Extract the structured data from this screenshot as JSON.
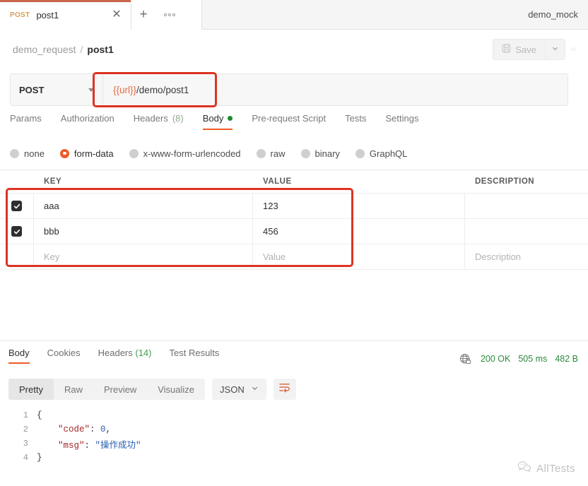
{
  "tab": {
    "method": "POST",
    "name": "post1",
    "close_icon": "close-icon",
    "new_tab_icon": "plus-icon",
    "more_icon": "more-options-icon",
    "environment": "demo_mock"
  },
  "breadcrumb": {
    "collection": "demo_request",
    "separator": "/",
    "current": "post1",
    "save_label": "Save",
    "save_icon": "floppy-disk-icon",
    "save_caret_icon": "chevron-down-icon"
  },
  "url_bar": {
    "method": "POST",
    "method_caret_icon": "chevron-down-icon",
    "url_variable": "{{url}}",
    "url_path": "/demo/post1",
    "highlight_color": "#dd3322",
    "variable_color": "#e8683f"
  },
  "request_tabs": [
    {
      "label": "Params",
      "active": false,
      "count": "",
      "dot": false
    },
    {
      "label": "Authorization",
      "active": false,
      "count": "",
      "dot": false
    },
    {
      "label": "Headers",
      "active": false,
      "count": "(8)",
      "dot": false
    },
    {
      "label": "Body",
      "active": true,
      "count": "",
      "dot": true
    },
    {
      "label": "Pre-request Script",
      "active": false,
      "count": "",
      "dot": false
    },
    {
      "label": "Tests",
      "active": false,
      "count": "",
      "dot": false
    },
    {
      "label": "Settings",
      "active": false,
      "count": "",
      "dot": false
    }
  ],
  "body_modes": [
    {
      "label": "none",
      "selected": false
    },
    {
      "label": "form-data",
      "selected": true
    },
    {
      "label": "x-www-form-urlencoded",
      "selected": false
    },
    {
      "label": "raw",
      "selected": false
    },
    {
      "label": "binary",
      "selected": false
    },
    {
      "label": "GraphQL",
      "selected": false
    }
  ],
  "kv_table": {
    "headers": {
      "key": "KEY",
      "value": "VALUE",
      "description": "DESCRIPTION"
    },
    "rows": [
      {
        "checked": true,
        "key": "aaa",
        "value": "123",
        "description": ""
      },
      {
        "checked": true,
        "key": "bbb",
        "value": "456",
        "description": ""
      }
    ],
    "placeholder_row": {
      "key": "Key",
      "value": "Value",
      "description": "Description"
    },
    "highlight_color": "#dd3322"
  },
  "response": {
    "tabs": [
      {
        "label": "Body",
        "active": true,
        "count": ""
      },
      {
        "label": "Cookies",
        "active": false,
        "count": ""
      },
      {
        "label": "Headers",
        "active": false,
        "count": "(14)"
      },
      {
        "label": "Test Results",
        "active": false,
        "count": ""
      }
    ],
    "security_icon": "globe-lock-icon",
    "status": "200 OK",
    "time": "505 ms",
    "size": "482 B",
    "status_color": "#2a8a3a",
    "view_modes": [
      {
        "label": "Pretty",
        "active": true
      },
      {
        "label": "Raw",
        "active": false
      },
      {
        "label": "Preview",
        "active": false
      },
      {
        "label": "Visualize",
        "active": false
      }
    ],
    "format": "JSON",
    "format_caret_icon": "chevron-down-icon",
    "wrap_icon": "wrap-text-icon",
    "code_lines": [
      {
        "num": "1",
        "parts": [
          {
            "t": "{",
            "c": "pun"
          }
        ]
      },
      {
        "num": "2",
        "parts": [
          {
            "t": "    \"code\"",
            "c": "key"
          },
          {
            "t": ": ",
            "c": "pun"
          },
          {
            "t": "0",
            "c": "num"
          },
          {
            "t": ",",
            "c": "pun"
          }
        ]
      },
      {
        "num": "3",
        "parts": [
          {
            "t": "    \"msg\"",
            "c": "key"
          },
          {
            "t": ": ",
            "c": "pun"
          },
          {
            "t": "\"操作成功\"",
            "c": "str"
          }
        ]
      },
      {
        "num": "4",
        "parts": [
          {
            "t": "}",
            "c": "pun"
          }
        ]
      }
    ]
  },
  "watermark": {
    "text": "AllTests",
    "icon": "wechat-icon"
  }
}
